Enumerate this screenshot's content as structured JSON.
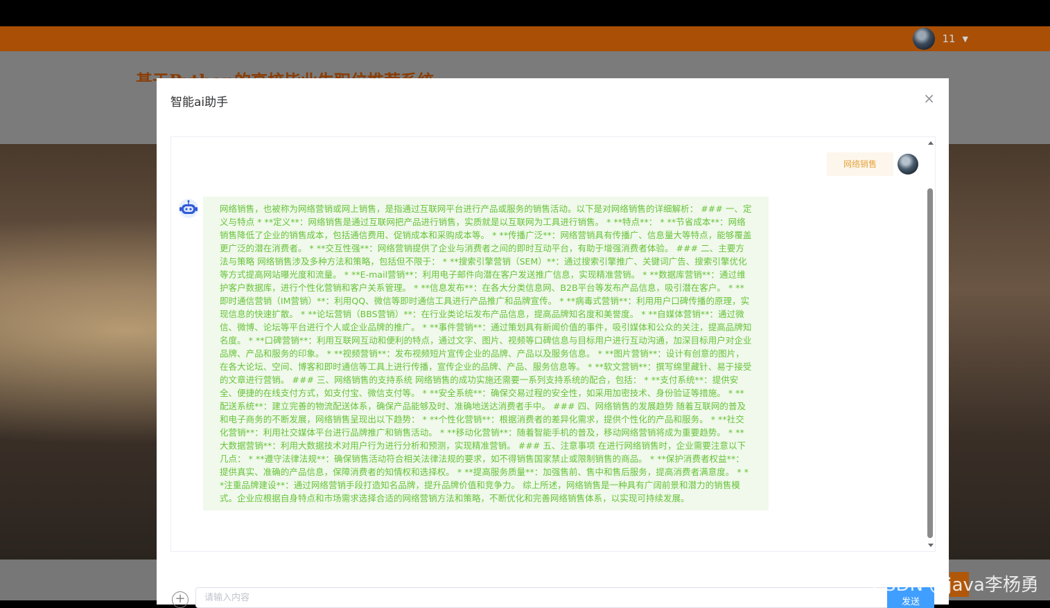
{
  "header": {
    "user_name": "11",
    "site_title": "基于Python的高校毕业生职位推荐系统"
  },
  "modal": {
    "title": "智能ai助手",
    "close_glyph": "×",
    "user_message": "网络销售",
    "bot_message": "网络销售，也被称为网络营销或网上销售，是指通过互联网平台进行产品或服务的销售活动。以下是对网络销售的详细解析： ### 一、定义与特点 * **定义**：网络销售是通过互联网把产品进行销售，实质就是以互联网为工具进行销售。 * **特点**： * **节省成本**：网络销售降低了企业的销售成本，包括通信费用、促销成本和采购成本等。 * **传播广泛**：网络营销具有传播广、信息量大等特点，能够覆盖更广泛的潜在消费者。 * **交互性强**：网络营销提供了企业与消费者之间的即时互动平台，有助于增强消费者体验。 ### 二、主要方法与策略 网络销售涉及多种方法和策略，包括但不限于： * **搜索引擎营销（SEM）**：通过搜索引擎推广、关键词广告、搜索引擎优化等方式提高网站曝光度和流量。 * **E-mail营销**：利用电子邮件向潜在客户发送推广信息，实现精准营销。 * **数据库营销**：通过维护客户数据库，进行个性化营销和客户关系管理。 * **信息发布**：在各大分类信息网、B2B平台等发布产品信息，吸引潜在客户。 * **即时通信营销（IM营销）**：利用QQ、微信等即时通信工具进行产品推广和品牌宣传。 * **病毒式营销**：利用用户口碑传播的原理，实现信息的快速扩散。 * **论坛营销（BBS营销）**：在行业类论坛发布产品信息，提高品牌知名度和美誉度。 * **自媒体营销**：通过微信、微博、论坛等平台进行个人或企业品牌的推广。 * **事件营销**：通过策划具有新闻价值的事件，吸引媒体和公众的关注，提高品牌知名度。 * **口碑营销**：利用互联网互动和便利的特点，通过文字、图片、视频等口碑信息与目标用户进行互动沟通，加深目标用户对企业品牌、产品和服务的印象。 * **视频营销**：发布视频短片宣传企业的品牌、产品以及服务信息。 * **图片营销**：设计有创意的图片，在各大论坛、空间、博客和即时通信等工具上进行传播，宣传企业的品牌、产品、服务信息等。 * **软文营销**：撰写绵里藏针、易于接受的文章进行营销。 ### 三、网络销售的支持系统 网络销售的成功实施还需要一系列支持系统的配合，包括： * **支付系统**：提供安全、便捷的在线支付方式，如支付宝、微信支付等。 * **安全系统**：确保交易过程的安全性，如采用加密技术、身份验证等措施。 * **配送系统**：建立完善的物流配送体系，确保产品能够及时、准确地送达消费者手中。 ### 四、网络销售的发展趋势 随着互联网的普及和电子商务的不断发展，网络销售呈现出以下趋势： * **个性化营销**：根据消费者的差异化需求，提供个性化的产品和服务。 * **社交化营销**：利用社交媒体平台进行品牌推广和销售活动。 * **移动化营销**：随着智能手机的普及，移动网络营销将成为重要趋势。 * **大数据营销**：利用大数据技术对用户行为进行分析和预测，实现精准营销。 ### 五、注意事项 在进行网络销售时，企业需要注意以下几点： * **遵守法律法规**：确保销售活动符合相关法律法规的要求，如不得销售国家禁止或限制销售的商品。 * **保护消费者权益**：提供真实、准确的产品信息，保障消费者的知情权和选择权。 * **提高服务质量**：加强售前、售中和售后服务，提高消费者满意度。 * **注重品牌建设**：通过网络营销手段打造知名品牌，提升品牌价值和竞争力。 综上所述，网络销售是一种具有广阔前景和潜力的销售模式。企业应根据自身特点和市场需求选择合适的网络营销方法和策略，不断优化和完善网络销售体系，以实现可持续发展。",
    "input_placeholder": "请输入内容",
    "send_label": "发送"
  },
  "watermark": "CSDN @java李杨勇",
  "colors": {
    "navbar": "#a94f06",
    "user_bubble_bg": "#fdf6ec",
    "user_bubble_text": "#e6a23c",
    "bot_bubble_bg": "#f0f9eb",
    "bot_bubble_text": "#67c23a",
    "send_button": "#409eff"
  }
}
